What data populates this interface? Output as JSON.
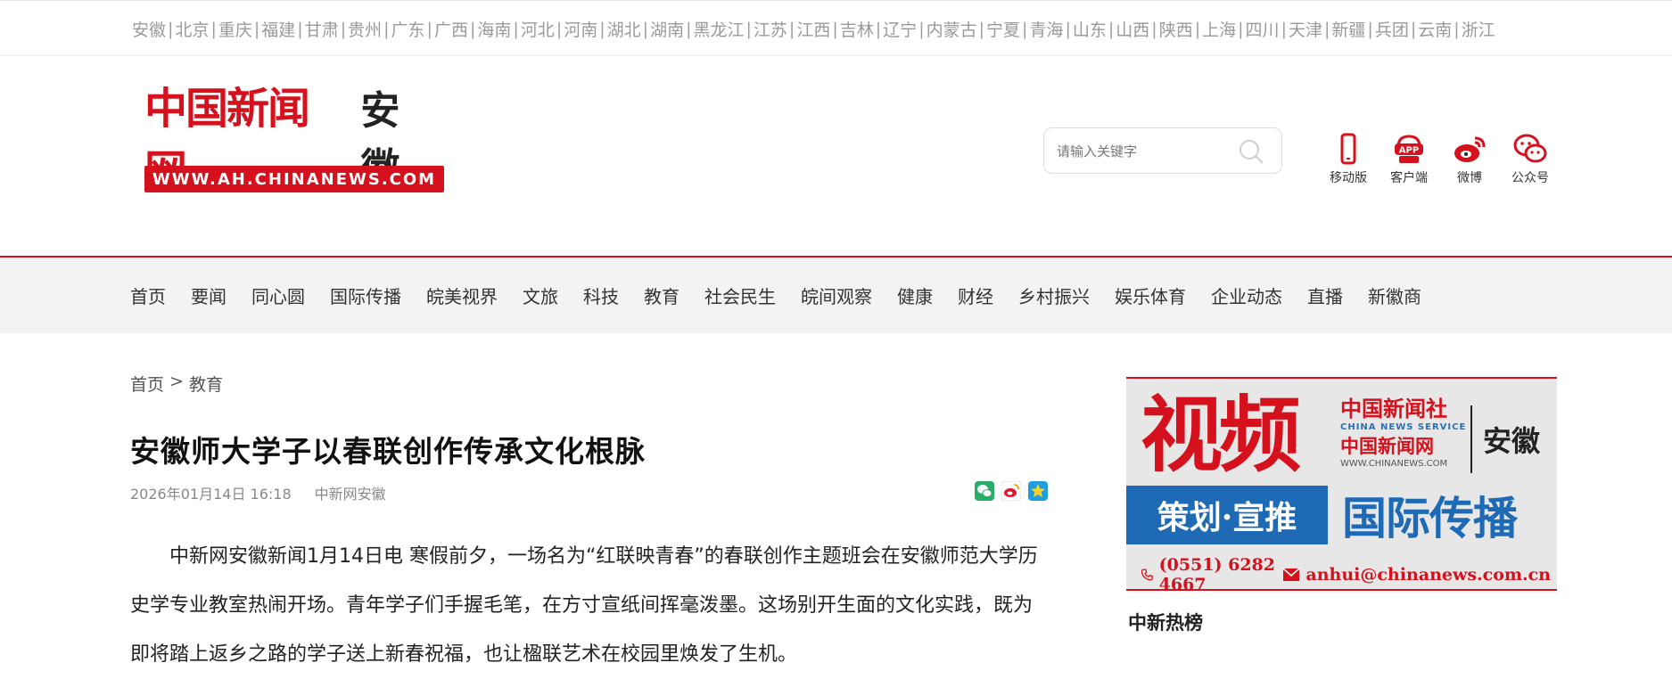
{
  "regions": [
    "安徽",
    "北京",
    "重庆",
    "福建",
    "甘肃",
    "贵州",
    "广东",
    "广西",
    "海南",
    "河北",
    "河南",
    "湖北",
    "湖南",
    "黑龙江",
    "江苏",
    "江西",
    "吉林",
    "辽宁",
    "内蒙古",
    "宁夏",
    "青海",
    "山东",
    "山西",
    "陕西",
    "上海",
    "四川",
    "天津",
    "新疆",
    "兵团",
    "云南",
    "浙江"
  ],
  "logo": {
    "title": "中国新闻网",
    "region": "安徽",
    "url": "WWW.AH.CHINANEWS.COM"
  },
  "search": {
    "placeholder": "请输入关键字",
    "icon": "search-icon"
  },
  "tools": [
    {
      "label": "移动版",
      "icon": "mobile-icon"
    },
    {
      "label": "客户端",
      "icon": "app-icon"
    },
    {
      "label": "微博",
      "icon": "weibo-icon"
    },
    {
      "label": "公众号",
      "icon": "wechat-icon"
    }
  ],
  "nav": [
    "首页",
    "要闻",
    "同心圆",
    "国际传播",
    "皖美视界",
    "文旅",
    "科技",
    "教育",
    "社会民生",
    "皖间观察",
    "健康",
    "财经",
    "乡村振兴",
    "娱乐体育",
    "企业动态",
    "直播",
    "新徽商"
  ],
  "breadcrumb": {
    "home": "首页",
    "sep": ">",
    "current": "教育"
  },
  "article": {
    "title": "安徽师大学子以春联创作传承文化根脉",
    "date": "2026年01月14日 16:18",
    "source": "中新网安徽",
    "body": "中新网安徽新闻1月14日电 寒假前夕，一场名为“红联映青春”的春联创作主题班会在安徽师范大学历史学专业教室热闹开场。青年学子们手握毛笔，在方寸宣纸间挥毫泼墨。这场别开生面的文化实践，既为即将踏上返乡之路的学子送上新春祝福，也让楹联艺术在校园里焕发了生机。"
  },
  "share_icons": [
    "wechat-share-icon",
    "weibo-share-icon",
    "qzone-share-icon"
  ],
  "ad": {
    "video": "视频",
    "brand_cn": "中国新闻社",
    "brand_en": "CHINA NEWS SERVICE",
    "brand_net": "中国新闻网",
    "brand_url": "WWW.CHINANEWS.COM",
    "region": "安徽",
    "plan": "策划·宣推",
    "intl": "国际传播",
    "phone": "(0551) 6282 4667",
    "email": "anhui@chinanews.com.cn"
  },
  "hot_title": "中新热榜",
  "colors": {
    "brand_red": "#d4111c",
    "ad_blue": "#1f6ab5",
    "nav_bg": "#f3f3f3"
  }
}
